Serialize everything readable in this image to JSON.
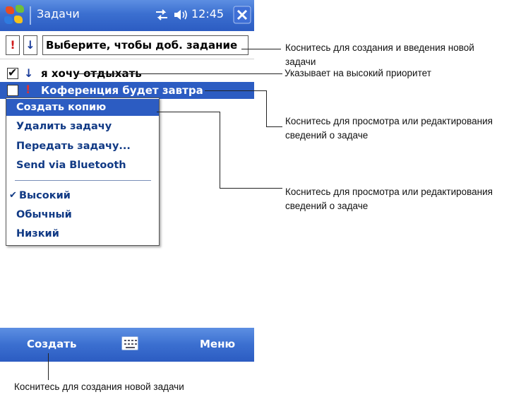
{
  "titlebar": {
    "app_title": "Задачи",
    "clock": "12:45",
    "start_icon": "windows-flag-icon",
    "connectivity_icon": "connectivity-icon",
    "volume_icon": "speaker-icon",
    "close_icon": "close-icon",
    "close_glyph": "✕",
    "bg_color": "#2c5cc2"
  },
  "entry_bar": {
    "high_priority_glyph": "!",
    "low_priority_glyph": "↓",
    "input_value": "Выберите, чтобы доб. задание"
  },
  "tasks": [
    {
      "checked": true,
      "check_glyph": "✔",
      "priority_glyph": "↓",
      "title": "я хочу отдыхать"
    },
    {
      "checked": false,
      "check_glyph": "",
      "priority_glyph": "!",
      "title": "Коференция будет завтра",
      "selected": true
    }
  ],
  "context_menu": {
    "items": [
      {
        "label": "Создать копию",
        "selected": true
      },
      {
        "label": "Удалить задачу"
      },
      {
        "label": "Передать задачу..."
      },
      {
        "label": "Send via Bluetooth"
      }
    ],
    "priority_items": [
      {
        "label": "Высокий",
        "checked": true,
        "check_glyph": "✔"
      },
      {
        "label": "Обычный"
      },
      {
        "label": "Низкий"
      }
    ],
    "accent_color": "#2c5cc2"
  },
  "bottom_bar": {
    "left_softkey": "Создать",
    "right_softkey": "Меню",
    "keyboard_icon": "keyboard-icon"
  },
  "callouts": [
    {
      "text": "Коснитесь для создания и введения новой задачи"
    },
    {
      "text": "Указывает на высокий приоритет"
    },
    {
      "text": "Коснитесь для просмотра или редактирования сведений о задаче"
    },
    {
      "text": "Коснитесь для просмотра или редактирования сведений о задаче"
    },
    {
      "text": "Коснитесь для создания новой задачи"
    }
  ]
}
